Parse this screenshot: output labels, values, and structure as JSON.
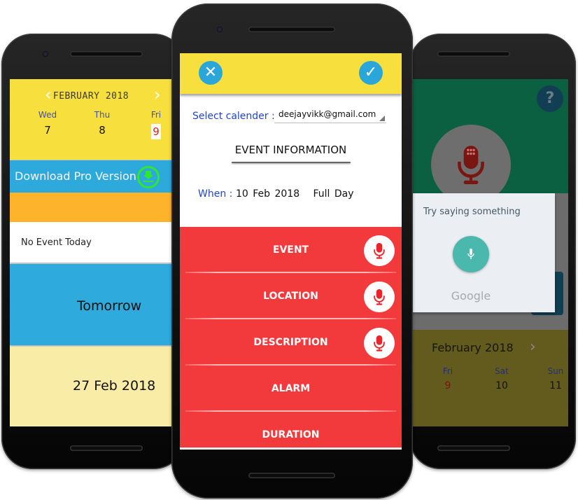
{
  "colors": {
    "yellow": "#f7df3d",
    "blue": "#2ea9dc",
    "orange": "#fdb42c",
    "pale_yellow": "#f8eca6",
    "red": "#f23a3d",
    "green": "#0a6040",
    "download_green": "#2ee82e",
    "label_blue": "#2146c8",
    "google_teal": "#4ab8ad"
  },
  "left_phone": {
    "calendar": {
      "month": "FEBRUARY 2018",
      "prev_icon": "chevron-left-icon",
      "next_icon": "chevron-right-icon",
      "days": [
        {
          "name": "Wed",
          "date": "7",
          "today": false
        },
        {
          "name": "Thu",
          "date": "8",
          "today": false
        },
        {
          "name": "Fri",
          "date": "9",
          "today": true
        }
      ]
    },
    "pro_banner": {
      "label": "Download Pro Version",
      "icon": "download-icon"
    },
    "today": {
      "label": "No Event Today"
    },
    "tomorrow": {
      "label": "Tomorrow"
    },
    "upcoming": {
      "label": "27 Feb 2018"
    }
  },
  "center_phone": {
    "toolbar": {
      "cancel_icon": "close-icon",
      "confirm_icon": "check-icon",
      "cancel_glyph": "✕",
      "confirm_glyph": "✓"
    },
    "select_calendar": {
      "label": "Select calender :",
      "value": "deejayvikk@gmail.com"
    },
    "section_title": "EVENT INFORMATION",
    "when": {
      "label": "When :",
      "date": "10 Feb 2018",
      "duration": "Full Day"
    },
    "fields": [
      {
        "label": "EVENT",
        "has_mic": true
      },
      {
        "label": "LOCATION",
        "has_mic": true
      },
      {
        "label": "DESCRIPTION",
        "has_mic": true
      },
      {
        "label": "ALARM",
        "has_mic": false
      },
      {
        "label": "DURATION",
        "has_mic": false
      }
    ]
  },
  "right_phone": {
    "help_glyph": "?",
    "voice_dialog": {
      "prompt": "Try saying something",
      "brand": "Google"
    },
    "calendar": {
      "month": "February 2018",
      "days": [
        {
          "name": "Fri",
          "date": "9",
          "today": true
        },
        {
          "name": "Sat",
          "date": "10",
          "today": false
        },
        {
          "name": "Sun",
          "date": "11",
          "today": false
        }
      ]
    }
  }
}
